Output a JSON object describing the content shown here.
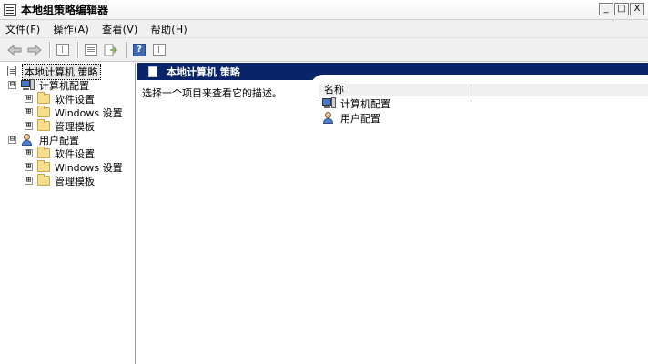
{
  "window": {
    "title": "本地组策略编辑器",
    "controls": {
      "minimize": "_",
      "maximize": "□",
      "close": "X"
    }
  },
  "menu": {
    "items": [
      "文件(F)",
      "操作(A)",
      "查看(V)",
      "帮助(H)"
    ]
  },
  "toolbar": {
    "back_icon": "back-arrow-icon",
    "forward_icon": "forward-arrow-icon",
    "help_label": "?"
  },
  "tree": {
    "root": "本地计算机 策略",
    "nodes": [
      {
        "label": "计算机配置",
        "expander": "⊟"
      },
      {
        "label": "软件设置",
        "expander": "⊞"
      },
      {
        "label": "Windows 设置",
        "expander": "⊞"
      },
      {
        "label": "管理模板",
        "expander": "⊞"
      },
      {
        "label": "用户配置",
        "expander": "⊟"
      },
      {
        "label": "软件设置",
        "expander": "⊞"
      },
      {
        "label": "Windows 设置",
        "expander": "⊞"
      },
      {
        "label": "管理模板",
        "expander": "⊞"
      }
    ]
  },
  "details": {
    "header_title": "本地计算机 策略",
    "description": "选择一个项目来查看它的描述。",
    "column_name": "名称",
    "items": [
      "计算机配置",
      "用户配置"
    ]
  },
  "colors": {
    "header_bg": "#0a246a",
    "folder": "#f6de8c"
  }
}
